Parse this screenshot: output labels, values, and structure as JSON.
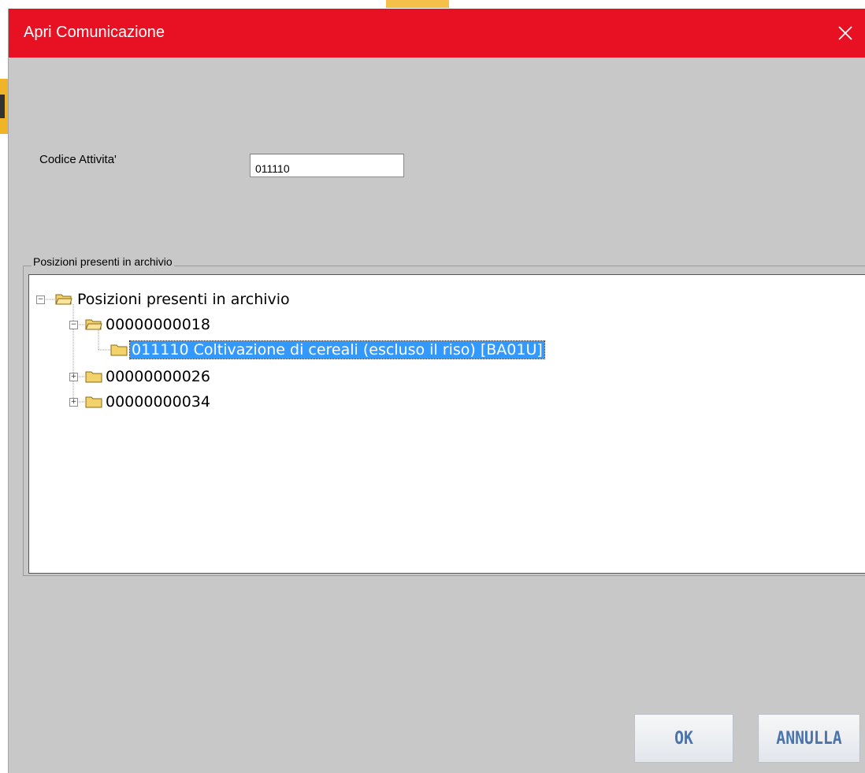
{
  "window": {
    "title": "Apri Comunicazione"
  },
  "form": {
    "codice_label": "Codice Attivita'",
    "codice_value": "011110"
  },
  "tree": {
    "group_title": "Posizioni presenti in archivio",
    "root": {
      "label": "Posizioni presenti in archivio",
      "expanded": true
    },
    "nodes": [
      {
        "label": "00000000018",
        "expanded": true
      },
      {
        "label": "011110 Coltivazione di cereali (escluso il riso) [BA01U]",
        "selected": true
      },
      {
        "label": "00000000026",
        "expanded": false
      },
      {
        "label": "00000000034",
        "expanded": false
      }
    ],
    "expand_glyph": "+",
    "collapse_glyph": "−"
  },
  "buttons": {
    "ok_label": "OK",
    "cancel_label": "ANNULLA"
  },
  "colors": {
    "titlebar": "#e81123",
    "dialog_bg": "#c8c8c8",
    "selection": "#3399ff",
    "button_text": "#4a74ad",
    "folder": "#f3d26b"
  }
}
